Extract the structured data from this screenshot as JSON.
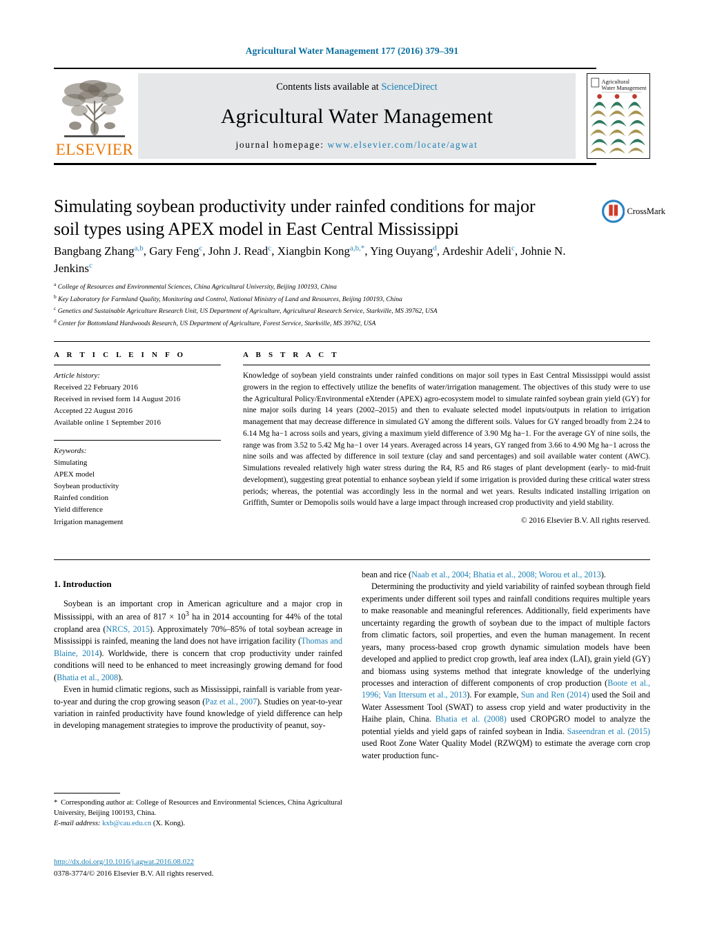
{
  "running_head": "Agricultural Water Management 177 (2016) 379–391",
  "masthead": {
    "contents_prefix": "Contents lists available at ",
    "contents_link": "ScienceDirect",
    "journal_name": "Agricultural Water Management",
    "homepage_prefix": "journal homepage: ",
    "homepage_url": "www.elsevier.com/locate/agwat",
    "publisher_logo_word": "ELSEVIER",
    "publisher_logo_icon": "elsevier-tree-icon",
    "cover_title_line1": "Agricultural",
    "cover_title_line2": "Water Management"
  },
  "article": {
    "title": "Simulating soybean productivity under rainfed conditions for major soil types using APEX model in East Central Mississippi",
    "crossmark_label": "CrossMark",
    "authors": [
      {
        "name": "Bangbang Zhang",
        "marks": "a,b"
      },
      {
        "name": "Gary Feng",
        "marks": "c"
      },
      {
        "name": "John J. Read",
        "marks": "c"
      },
      {
        "name": "Xiangbin Kong",
        "marks": "a,b,*"
      },
      {
        "name": "Ying Ouyang",
        "marks": "d"
      },
      {
        "name": "Ardeshir Adeli",
        "marks": "c"
      },
      {
        "name": "Johnie N. Jenkins",
        "marks": "c"
      }
    ],
    "affiliations": [
      {
        "mark": "a",
        "text": "College of Resources and Environmental Sciences, China Agricultural University, Beijing 100193, China"
      },
      {
        "mark": "b",
        "text": "Key Laboratory for Farmland Quality, Monitoring and Control, National Ministry of Land and Resources, Beijing 100193, China"
      },
      {
        "mark": "c",
        "text": "Genetics and Sustainable Agriculture Research Unit, US Department of Agriculture, Agricultural Research Service, Starkville, MS 39762, USA"
      },
      {
        "mark": "d",
        "text": "Center for Bottomland Hardwoods Research, US Department of Agriculture, Forest Service, Starkville, MS 39762, USA"
      }
    ]
  },
  "article_info": {
    "heading": "A R T I C L E   I N F O",
    "history_label": "Article history:",
    "history": [
      "Received 22 February 2016",
      "Received in revised form 14 August 2016",
      "Accepted 22 August 2016",
      "Available online 1 September 2016"
    ],
    "keywords_label": "Keywords:",
    "keywords": [
      "Simulating",
      "APEX model",
      "Soybean productivity",
      "Rainfed condition",
      "Yield difference",
      "Irrigation management"
    ]
  },
  "abstract": {
    "heading": "A B S T R A C T",
    "text": "Knowledge of soybean yield constraints under rainfed conditions on major soil types in East Central Mississippi would assist growers in the region to effectively utilize the benefits of water/irrigation management. The objectives of this study were to use the Agricultural Policy/Environmental eXtender (APEX) agro-ecosystem model to simulate rainfed soybean grain yield (GY) for nine major soils during 14 years (2002–2015) and then to evaluate selected model inputs/outputs in relation to irrigation management that may decrease difference in simulated GY among the different soils. Values for GY ranged broadly from 2.24 to 6.14 Mg ha−1 across soils and years, giving a maximum yield difference of 3.90 Mg ha−1. For the average GY of nine soils, the range was from 3.52 to 5.42 Mg ha−1 over 14 years. Averaged across 14 years, GY ranged from 3.66 to 4.90 Mg ha−1 across the nine soils and was affected by difference in soil texture (clay and sand percentages) and soil available water content (AWC). Simulations revealed relatively high water stress during the R4, R5 and R6 stages of plant development (early- to mid-fruit development), suggesting great potential to enhance soybean yield if some irrigation is provided during these critical water stress periods; whereas, the potential was accordingly less in the normal and wet years. Results indicated installing irrigation on Griffith, Sumter or Demopolis soils would have a large impact through increased crop productivity and yield stability.",
    "copyright": "© 2016 Elsevier B.V. All rights reserved."
  },
  "body": {
    "section_heading": "1.  Introduction",
    "left_paragraphs": [
      {
        "parts": [
          {
            "t": "Soybean is an important crop in American agriculture and a major crop in Mississippi, with an area of 817 × 10",
            "k": "text"
          },
          {
            "t": "3",
            "k": "sup"
          },
          {
            "t": " ha in 2014 accounting for 44% of the total cropland area (",
            "k": "text"
          },
          {
            "t": "NRCS, 2015",
            "k": "cite"
          },
          {
            "t": "). Approximately 70%–85% of total soybean acreage in Mississippi is rainfed, meaning the land does not have irrigation facility (",
            "k": "text"
          },
          {
            "t": "Thomas and Blaine, 2014",
            "k": "cite"
          },
          {
            "t": "). Worldwide, there is concern that crop productivity under rainfed conditions will need to be enhanced to meet increasingly growing demand for food (",
            "k": "text"
          },
          {
            "t": "Bhatia et al., 2008",
            "k": "cite"
          },
          {
            "t": ").",
            "k": "text"
          }
        ]
      },
      {
        "parts": [
          {
            "t": "Even in humid climatic regions, such as Mississippi, rainfall is variable from year-to-year and during the crop growing season (",
            "k": "text"
          },
          {
            "t": "Paz et al., 2007",
            "k": "cite"
          },
          {
            "t": "). Studies on year-to-year variation in rainfed productivity have found knowledge of yield difference can help in developing management strategies to improve the productivity of peanut, soy-",
            "k": "text"
          }
        ]
      }
    ],
    "right_paragraphs": [
      {
        "indent": false,
        "parts": [
          {
            "t": "bean and rice (",
            "k": "text"
          },
          {
            "t": "Naab et al., 2004; Bhatia et al., 2008; Worou et al., 2013",
            "k": "cite"
          },
          {
            "t": ").",
            "k": "text"
          }
        ]
      },
      {
        "indent": true,
        "parts": [
          {
            "t": "Determining the productivity and yield variability of rainfed soybean through field experiments under different soil types and rainfall conditions requires multiple years to make reasonable and meaningful references. Additionally, field experiments have uncertainty regarding the growth of soybean due to the impact of multiple factors from climatic factors, soil properties, and even the human management. In recent years, many process-based crop growth dynamic simulation models have been developed and applied to predict crop growth, leaf area index (LAI), grain yield (GY) and biomass using systems method that integrate knowledge of the underlying processes and interaction of different components of crop production (",
            "k": "text"
          },
          {
            "t": "Boote et al., 1996; Van Ittersum et al., 2013",
            "k": "cite"
          },
          {
            "t": "). For example, ",
            "k": "text"
          },
          {
            "t": "Sun and Ren (2014)",
            "k": "cite"
          },
          {
            "t": " used the Soil and Water Assessment Tool (SWAT) to assess crop yield and water productivity in the Haihe plain, China. ",
            "k": "text"
          },
          {
            "t": "Bhatia et al. (2008)",
            "k": "cite"
          },
          {
            "t": " used CROPGRO model to analyze the potential yields and yield gaps of rainfed soybean in India. ",
            "k": "text"
          },
          {
            "t": "Saseendran et al. (2015)",
            "k": "cite"
          },
          {
            "t": " used Root Zone Water Quality Model (RZWQM) to estimate the average corn crop water production func-",
            "k": "text"
          }
        ]
      }
    ]
  },
  "footnote": {
    "star": "*",
    "corresponding": "Corresponding author at: College of Resources and Environmental Sciences, China Agricultural University, Beijing 100193, China.",
    "email_label": "E-mail address:",
    "email": "kxb@cau.edu.cn",
    "email_owner": "(X. Kong)."
  },
  "doi": {
    "url": "http://dx.doi.org/10.1016/j.agwat.2016.08.022",
    "issn_line": "0378-3774/© 2016 Elsevier B.V. All rights reserved."
  },
  "colors": {
    "link_blue": "#1a7fb5",
    "elsevier_orange": "#ec7404",
    "masthead_gray": "#e6e7e8",
    "cover_green": "#2f7a5e",
    "cover_tan": "#a89451",
    "cover_red": "#c0392b"
  }
}
